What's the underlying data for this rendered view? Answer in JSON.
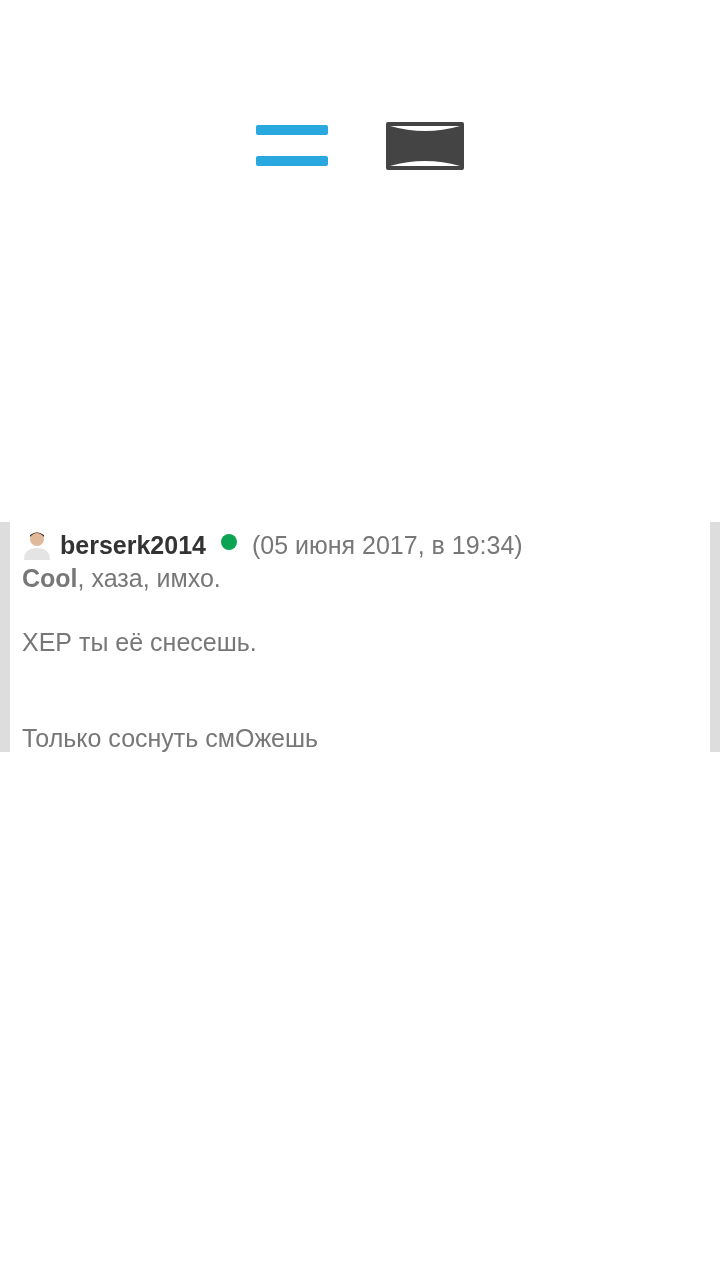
{
  "comment": {
    "author": "berserk2014",
    "online": true,
    "date": "(05 июня 2017, в 19:34)",
    "paragraphs": [
      "**Cool**, хаза, имхо.",
      "ХЕР ты её снесешь.",
      "Только соснуть смОжешь"
    ]
  }
}
